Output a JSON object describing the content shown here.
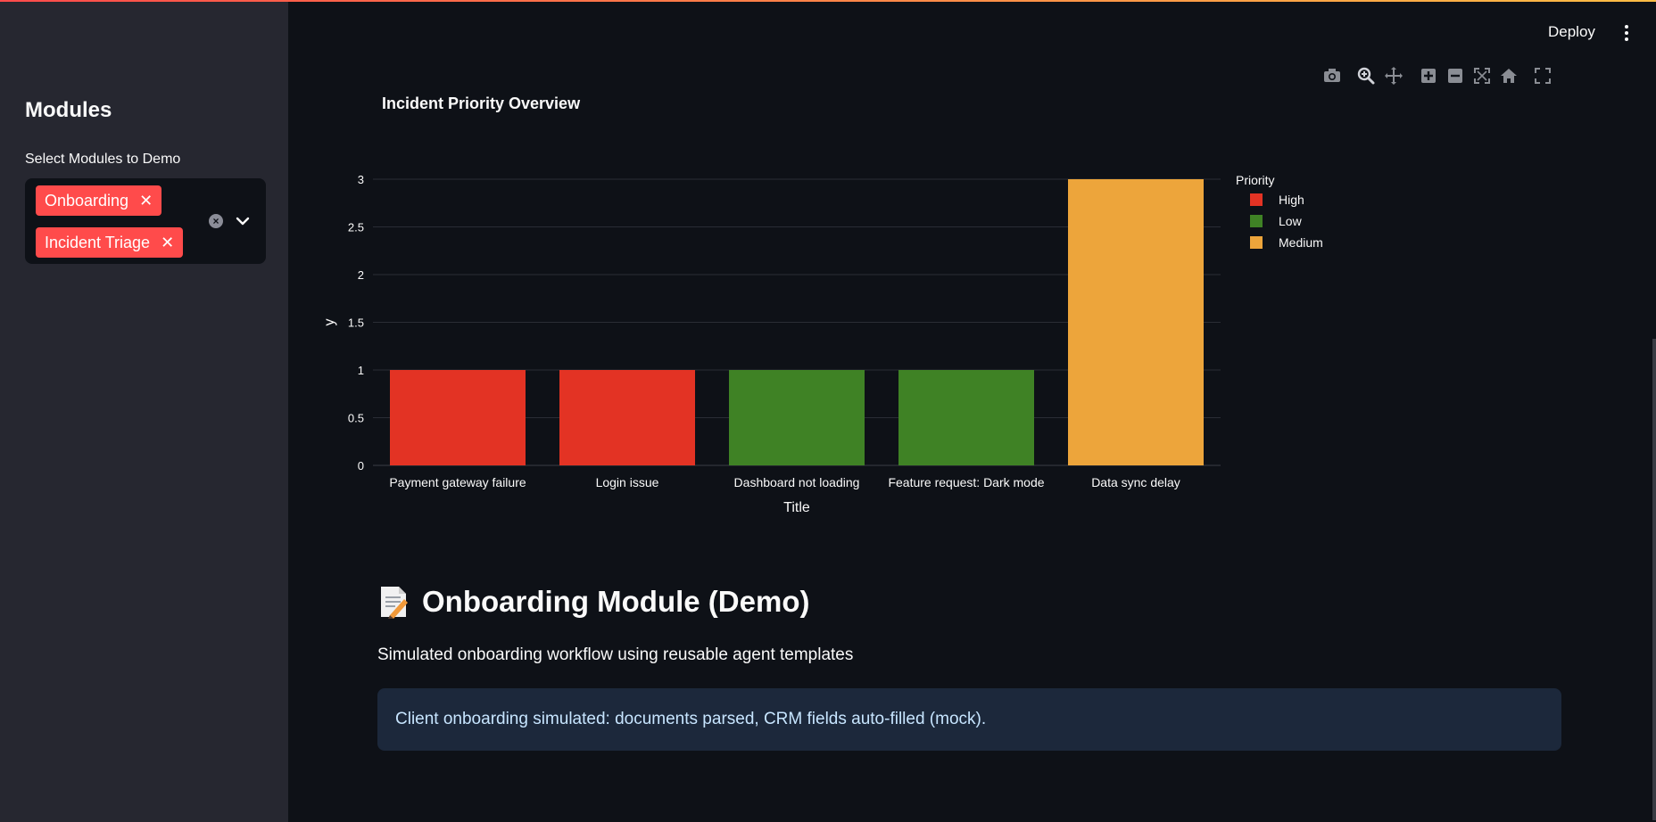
{
  "sidebar": {
    "title": "Modules",
    "select_label": "Select Modules to Demo",
    "selected": [
      {
        "label": "Onboarding"
      },
      {
        "label": "Incident Triage"
      }
    ]
  },
  "header": {
    "deploy_label": "Deploy"
  },
  "modebar": [
    "camera-icon",
    "zoom-icon",
    "pan-icon",
    "zoom-in-icon",
    "zoom-out-icon",
    "autoscale-icon",
    "reset-axes-icon",
    "fullscreen-icon"
  ],
  "chart": {
    "title": "Incident Priority Overview"
  },
  "chart_data": {
    "type": "bar",
    "xlabel": "Title",
    "ylabel": "y",
    "ylim": [
      0,
      3
    ],
    "yticks": [
      "0",
      "0.5",
      "1",
      "1.5",
      "2",
      "2.5",
      "3"
    ],
    "ytick_values": [
      0,
      0.5,
      1,
      1.5,
      2,
      2.5,
      3
    ],
    "categories": [
      "Payment gateway failure",
      "Login issue",
      "Dashboard not loading",
      "Feature request: Dark mode",
      "Data sync delay"
    ],
    "values": [
      1,
      1,
      1,
      1,
      3
    ],
    "priority": [
      "High",
      "High",
      "Low",
      "Low",
      "Medium"
    ],
    "legend": {
      "title": "Priority",
      "placement": "right",
      "entries": [
        {
          "name": "High",
          "color": "#e33324"
        },
        {
          "name": "Low",
          "color": "#3f8225"
        },
        {
          "name": "Medium",
          "color": "#eda53b"
        }
      ]
    },
    "grid": true
  },
  "onboarding": {
    "title": "Onboarding Module (Demo)",
    "icon": "memo-icon",
    "subtitle": "Simulated onboarding workflow using reusable agent templates",
    "info": "Client onboarding simulated: documents parsed, CRM fields auto-filled (mock)."
  },
  "colors": {
    "accent": "#ff4b4b",
    "info_bg": "#1c283b",
    "info_text": "#c7e5ff"
  }
}
